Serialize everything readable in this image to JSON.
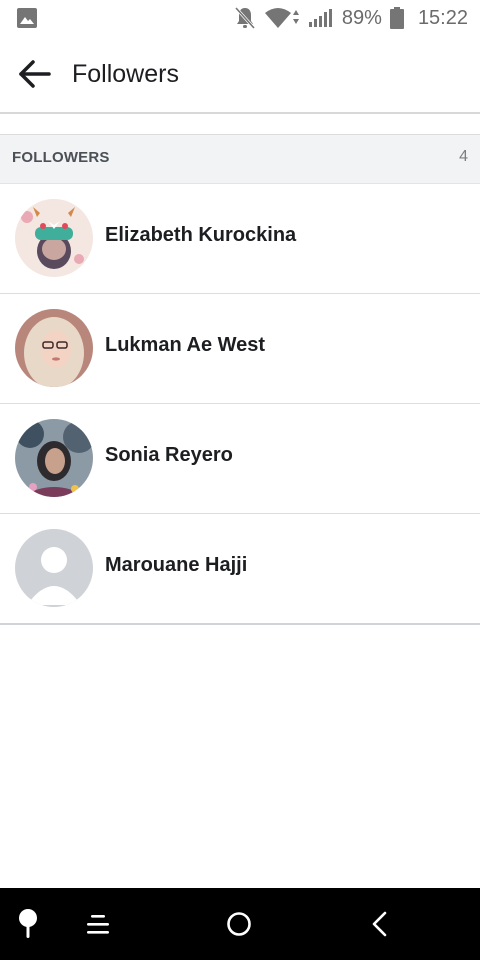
{
  "status_bar": {
    "battery": "89%",
    "time": "15:22",
    "icons": [
      "gallery-icon",
      "notifications-off-icon",
      "wifi-icon",
      "signal-icon",
      "battery-icon"
    ]
  },
  "app_bar": {
    "title": "Followers",
    "back_icon": "arrow-back-icon"
  },
  "section": {
    "title": "FOLLOWERS",
    "count": "4"
  },
  "followers": [
    {
      "name": "Elizabeth Kurockina"
    },
    {
      "name": "Lukman Ae West"
    },
    {
      "name": "Sonia Reyero"
    },
    {
      "name": "Marouane Hajji"
    }
  ],
  "nav_bar": {
    "icons": [
      "pin-icon",
      "menu-icon",
      "home-icon",
      "back-icon"
    ]
  },
  "colors": {
    "background": "#ffffff",
    "section_background": "#f2f3f5",
    "text_primary": "#1c1e21",
    "text_secondary": "#4b4f56",
    "nav_bar": "#000000"
  }
}
